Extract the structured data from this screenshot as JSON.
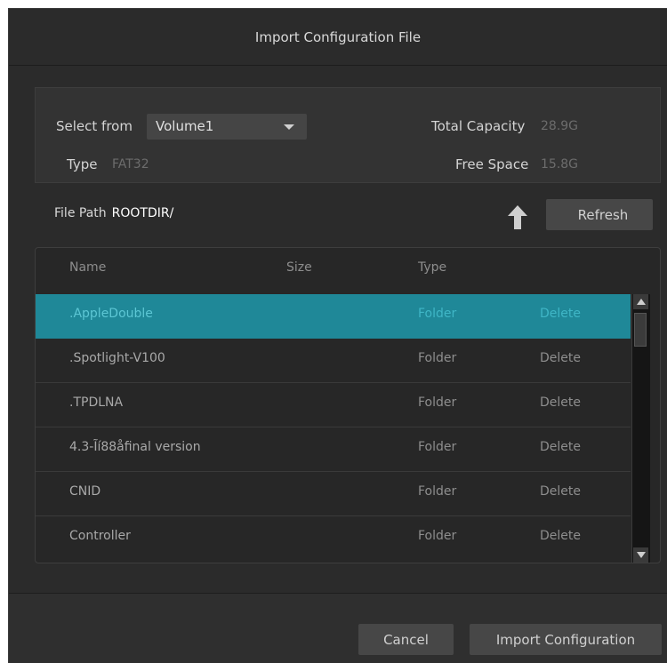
{
  "dialog": {
    "title": "Import Configuration File"
  },
  "info": {
    "select_from_label": "Select from",
    "volume_value": "Volume1",
    "type_label": "Type",
    "type_value": "FAT32",
    "total_capacity_label": "Total Capacity",
    "total_capacity_value": "28.9G",
    "free_space_label": "Free Space",
    "free_space_value": "15.8G"
  },
  "path": {
    "label": "File Path",
    "value": "ROOTDIR/"
  },
  "toolbar": {
    "refresh_label": "Refresh",
    "up_icon": "arrow-up-icon"
  },
  "table": {
    "columns": [
      "Name",
      "Size",
      "Type"
    ],
    "rows": [
      {
        "name": ".AppleDouble",
        "size": "",
        "type": "Folder",
        "action": "Delete",
        "selected": true
      },
      {
        "name": ".Spotlight-V100",
        "size": "",
        "type": "Folder",
        "action": "Delete"
      },
      {
        "name": ".TPDLNA",
        "size": "",
        "type": "Folder",
        "action": "Delete"
      },
      {
        "name": "4.3-Ĩí88åfinal version",
        "size": "",
        "type": "Folder",
        "action": "Delete"
      },
      {
        "name": "CNID",
        "size": "",
        "type": "Folder",
        "action": "Delete"
      },
      {
        "name": "Controller",
        "size": "",
        "type": "Folder",
        "action": "Delete"
      }
    ]
  },
  "footer": {
    "cancel_label": "Cancel",
    "import_label": "Import Configuration"
  },
  "colors": {
    "accent": "#1f8898",
    "background": "#2b2b2b"
  }
}
